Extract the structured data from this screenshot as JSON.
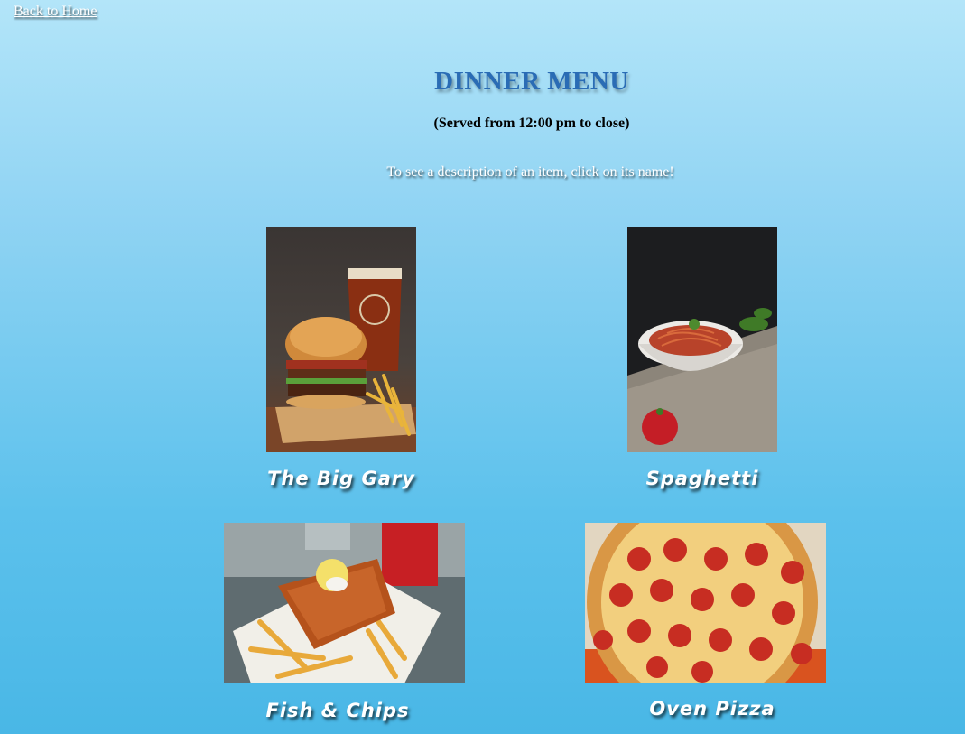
{
  "nav": {
    "back_label": "Back to Home"
  },
  "header": {
    "title": "DINNER MENU",
    "served": "(Served from 12:00 pm to close)",
    "instructions": "To see a description of an item, click on its name!"
  },
  "menu": {
    "items": [
      {
        "name": "The Big Gary",
        "image": "burger-with-beer-and-fries"
      },
      {
        "name": "Spaghetti",
        "image": "spaghetti-bowl-on-board"
      },
      {
        "name": "Fish & Chips",
        "image": "fried-fish-with-fries"
      },
      {
        "name": "Oven Pizza",
        "image": "pepperoni-pizza-in-box"
      }
    ]
  },
  "colors": {
    "title": "#2a6cb5",
    "background_top": "#b3e5f9",
    "background_bottom": "#49b7e6"
  }
}
